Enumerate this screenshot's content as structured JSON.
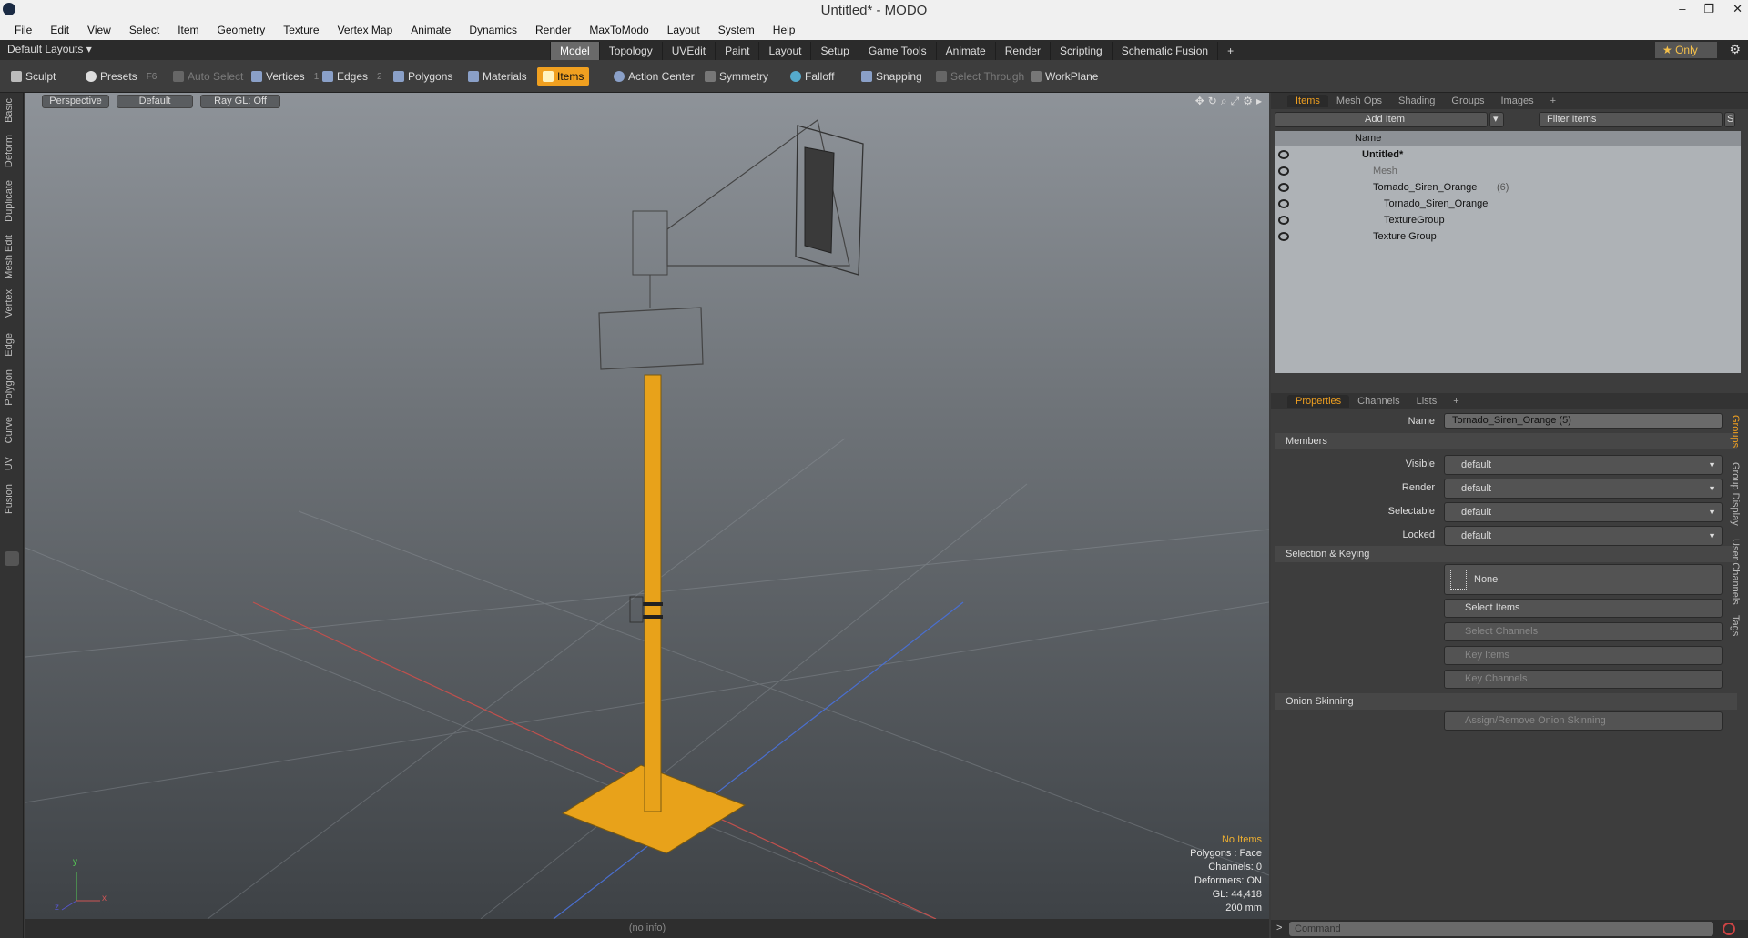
{
  "window": {
    "title": "Untitled* - MODO",
    "controls": [
      "–",
      "❐",
      "✕"
    ]
  },
  "menu": [
    "File",
    "Edit",
    "View",
    "Select",
    "Item",
    "Geometry",
    "Texture",
    "Vertex Map",
    "Animate",
    "Dynamics",
    "Render",
    "MaxToModo",
    "Layout",
    "System",
    "Help"
  ],
  "layoutbar": {
    "layouts_label": "Default Layouts ▾",
    "tabs": [
      "Model",
      "Topology",
      "UVEdit",
      "Paint",
      "Layout",
      "Setup",
      "Game Tools",
      "Animate",
      "Render",
      "Scripting",
      "Schematic Fusion",
      "+"
    ],
    "active_tab": "Model",
    "only_label": "★ Only"
  },
  "toolbar": {
    "sculpt": "Sculpt",
    "presets": "Presets",
    "presets_key": "F6",
    "auto_select": "Auto Select",
    "vertices": "Vertices",
    "vertices_key": "1",
    "edges": "Edges",
    "edges_key": "2",
    "polygons": "Polygons",
    "materials": "Materials",
    "items": "Items",
    "action_center": "Action Center",
    "symmetry": "Symmetry",
    "falloff": "Falloff",
    "snapping": "Snapping",
    "select_through": "Select Through",
    "workplane": "WorkPlane"
  },
  "left_tabs": [
    "Basic",
    "Deform",
    "Duplicate",
    "Mesh Edit",
    "Vertex",
    "Edge",
    "Polygon",
    "Curve",
    "UV",
    "Fusion"
  ],
  "viewport": {
    "view": "Perspective",
    "shading": "Default",
    "raygl": "Ray GL: Off",
    "info": {
      "items": "No Items",
      "polygons": "Polygons : Face",
      "channels": "Channels: 0",
      "deformers": "Deformers: ON",
      "gl": "GL: 44,418",
      "scale": "200 mm"
    },
    "axis_x": "x",
    "axis_y": "y",
    "axis_z": "z"
  },
  "status": "(no info)",
  "items_panel": {
    "tabs": [
      "Items",
      "Mesh Ops",
      "Shading",
      "Groups",
      "Images",
      "+"
    ],
    "active": "Items",
    "add_item": "Add Item",
    "filter_placeholder": "Filter Items",
    "col_name": "Name",
    "rows": [
      {
        "label": "Untitled*",
        "indent": 80
      },
      {
        "label": "Mesh",
        "indent": 92
      },
      {
        "label": "Tornado_Siren_Orange",
        "count": "(6)",
        "indent": 92
      },
      {
        "label": "Tornado_Siren_Orange",
        "indent": 104
      },
      {
        "label": "TextureGroup",
        "indent": 104
      },
      {
        "label": "Texture Group",
        "indent": 92
      }
    ]
  },
  "properties_panel": {
    "tabs": [
      "Properties",
      "Channels",
      "Lists",
      "+"
    ],
    "active": "Properties",
    "name_label": "Name",
    "name_value": "Tornado_Siren_Orange (5)",
    "sections": {
      "members": "Members",
      "keying": "Selection & Keying",
      "onion": "Onion Skinning"
    },
    "visible_label": "Visible",
    "visible_value": "default",
    "render_label": "Render",
    "render_value": "default",
    "selectable_label": "Selectable",
    "selectable_value": "default",
    "locked_label": "Locked",
    "locked_value": "default",
    "none_label": "None",
    "select_items": "Select Items",
    "select_channels": "Select Channels",
    "key_items": "Key Items",
    "key_channels": "Key Channels",
    "onion_btn": "Assign/Remove Onion Skinning",
    "side_tabs": [
      "Groups",
      "Group Display",
      "User Channels",
      "Tags"
    ]
  },
  "command": {
    "placeholder": "Command",
    "prompt": ">"
  },
  "colors": {
    "accent": "#f0a020",
    "viewport_top": "#8e9399",
    "viewport_bottom": "#3e4246",
    "model": "#e8a21a"
  }
}
